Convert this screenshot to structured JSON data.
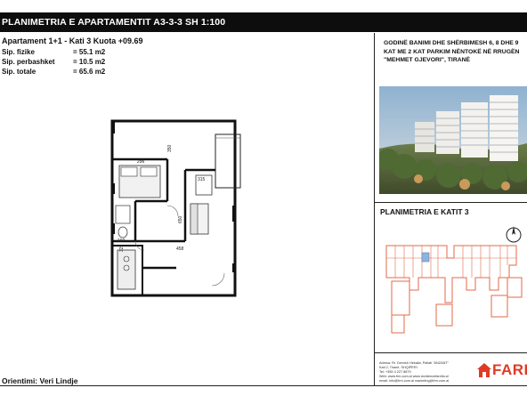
{
  "header": {
    "title": "PLANIMETRIA E APARTAMENTIT A3-3-3  SH 1:100"
  },
  "apartment": {
    "heading": "Apartament 1+1 -  Kati 3   Kuota  +09.69",
    "areas": [
      {
        "label": "Sip. fizike",
        "value": "=    55.1 m2"
      },
      {
        "label": "Sip. perbashket",
        "value": "=    10.5 m2"
      },
      {
        "label": "Sip. totale",
        "value": "=    65.6 m2"
      }
    ]
  },
  "plan": {
    "dimensions": [
      "296",
      "350",
      "315",
      "650",
      "458",
      "329",
      "160"
    ],
    "description_icon": "apartment-floorplan-drawing"
  },
  "orientation": "Orientimi: Veri Lindje",
  "project": {
    "description_lines": [
      "GODINË BANIMI DHE SHËRBIMESH 6, 8 DHE 9",
      "KAT ME 2 KAT PARKIM NËNTOKË NË RRUGËN",
      "\"MEHMET GJEVORI\", TIRANË"
    ],
    "photo_icon": "building-render-photo"
  },
  "floor_plan": {
    "title": "PLANIMETRIA E KATIT 3",
    "north_icon": "north-arrow-icon",
    "highlight_color": "#8fb3df",
    "outline_color": "#e36a4a"
  },
  "contact": {
    "lines": [
      "Adresa: Rr. Dervish Hekalia, Pallati \"ANZANT\"",
      "Kati 2, Tiranë, SHQIPËRI",
      "Tel: +355 4 227 8879",
      "Web: www.frm.com.al   www.rezidencefarella.al",
      "email: info@frm.com.al   marketing@frm.com.al"
    ]
  },
  "brand": {
    "name": "FARE",
    "color": "#e03a25"
  }
}
